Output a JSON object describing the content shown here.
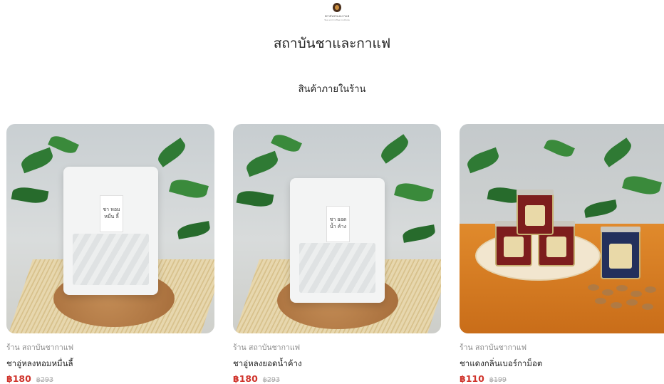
{
  "header": {
    "logo_text": "สถาบันชาและกาแฟ",
    "logo_sub": "Tea and Coffee Institute",
    "store_title": "สถาบันชาและกาแฟ",
    "section_title": "สินค้าภายในร้าน"
  },
  "products": [
    {
      "shop": "ร้าน สถาบันชากาแฟ",
      "name": "ชาอู่หลงหอมหมื่นลี้",
      "price": "฿180",
      "old_price": "฿293",
      "tag_text": "ชา หอม หมื่น ลี้"
    },
    {
      "shop": "ร้าน สถาบันชากาแฟ",
      "name": "ชาอู่หลงยอดน้ำค้าง",
      "price": "฿180",
      "old_price": "฿293",
      "tag_text": "ชา ยอด น้ำ ค้าง"
    },
    {
      "shop": "ร้าน สถาบันชากาแฟ",
      "name": "ชาแดงกลิ่นเบอร์กาม็อต",
      "price": "฿110",
      "old_price": "฿199"
    }
  ],
  "colors": {
    "price": "#d0342c",
    "old_price": "#aaaaaa"
  }
}
